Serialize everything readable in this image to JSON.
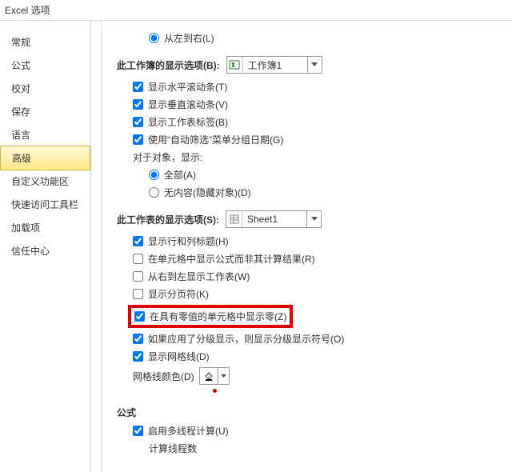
{
  "window_title": "Excel 选项",
  "sidebar": {
    "items": [
      {
        "label": "常规"
      },
      {
        "label": "公式"
      },
      {
        "label": "校对"
      },
      {
        "label": "保存"
      },
      {
        "label": "语言"
      },
      {
        "label": "高级"
      },
      {
        "label": "自定义功能区"
      },
      {
        "label": "快速访问工具栏"
      },
      {
        "label": "加载项"
      },
      {
        "label": "信任中心"
      }
    ],
    "selected_index": 5
  },
  "content": {
    "default_direction": {
      "label": "从左到右(L)"
    },
    "workbook_section": {
      "label": "此工作簿的显示选项(B):",
      "combo_value": "工作簿1",
      "items": [
        {
          "label": "显示水平滚动条(T)",
          "checked": true
        },
        {
          "label": "显示垂直滚动条(V)",
          "checked": true
        },
        {
          "label": "显示工作表标签(B)",
          "checked": true
        },
        {
          "label": "使用“自动筛选”菜单分组日期(G)",
          "checked": true
        }
      ],
      "objects": {
        "label": "对于对象，显示:",
        "options": [
          {
            "label": "全部(A)",
            "checked": true
          },
          {
            "label": "无内容(隐藏对象)(D)",
            "checked": false
          }
        ]
      }
    },
    "worksheet_section": {
      "label": "此工作表的显示选项(S):",
      "combo_value": "Sheet1",
      "items": [
        {
          "label": "显示行和列标题(H)",
          "checked": true
        },
        {
          "label": "在单元格中显示公式而非其计算结果(R)",
          "checked": false
        },
        {
          "label": "从右到左显示工作表(W)",
          "checked": false
        },
        {
          "label": "显示分页符(K)",
          "checked": false
        },
        {
          "label": "在具有零值的单元格中显示零(Z)",
          "checked": true,
          "highlight": true
        },
        {
          "label": "如果应用了分级显示，则显示分级显示符号(O)",
          "checked": true
        },
        {
          "label": "显示网格线(D)",
          "checked": true
        }
      ],
      "gridline_color_label": "网格线颜色(D)"
    },
    "formulas_section": {
      "title": "公式",
      "items": [
        {
          "label": "启用多线程计算(U)",
          "checked": true
        }
      ],
      "sub_label": "计算线程数"
    }
  }
}
